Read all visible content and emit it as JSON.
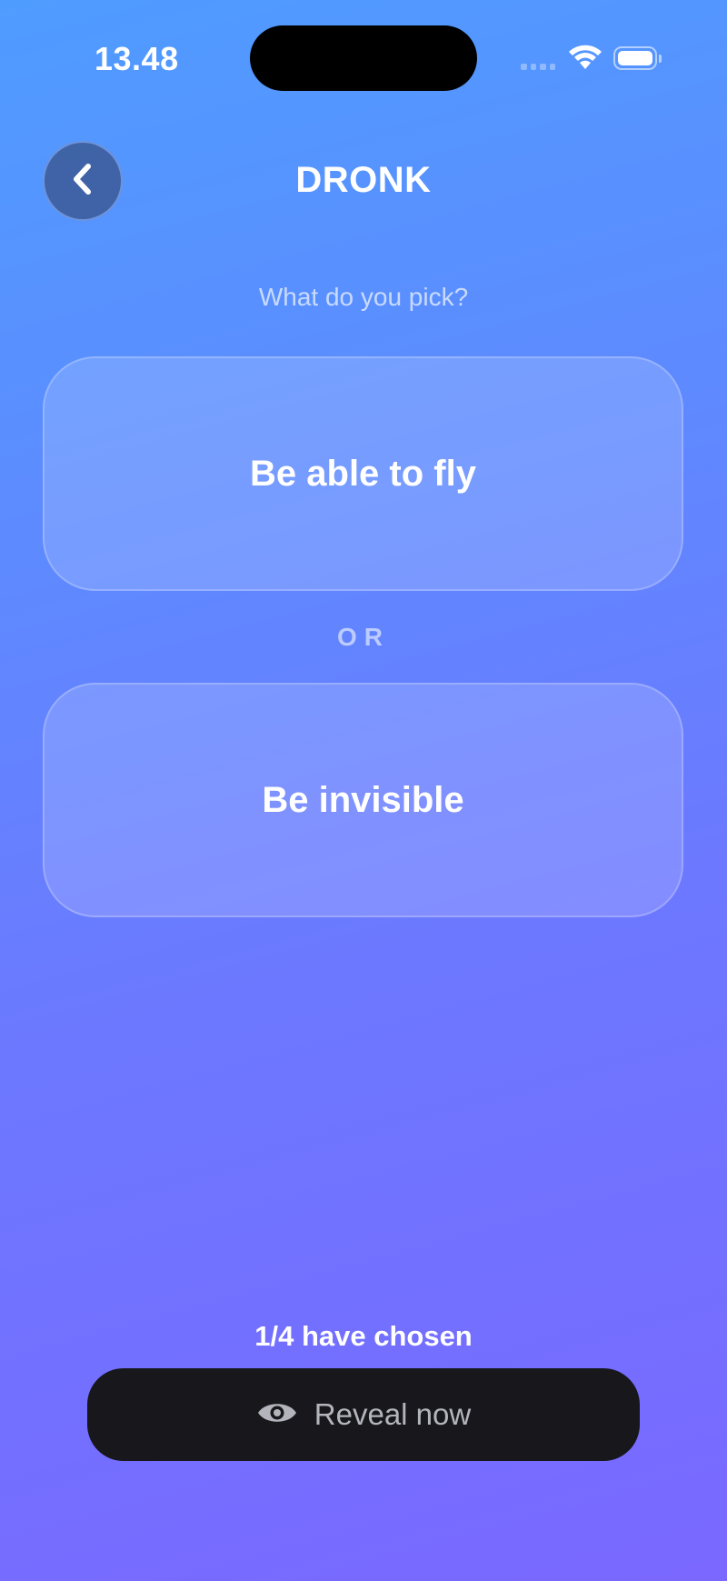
{
  "status_bar": {
    "time": "13.48"
  },
  "header": {
    "title": "DRONK",
    "back_icon": "chevron-left-icon"
  },
  "question": {
    "prompt": "What do you pick?",
    "option_a": "Be able to fly",
    "separator": "OR",
    "option_b": "Be invisible"
  },
  "footer": {
    "chosen_status": "1/4 have chosen",
    "reveal_label": "Reveal now",
    "reveal_icon": "eye-icon"
  },
  "colors": {
    "background_top": "#4f9cff",
    "background_bottom": "#7a68ff",
    "button_dark": "#17171c"
  }
}
